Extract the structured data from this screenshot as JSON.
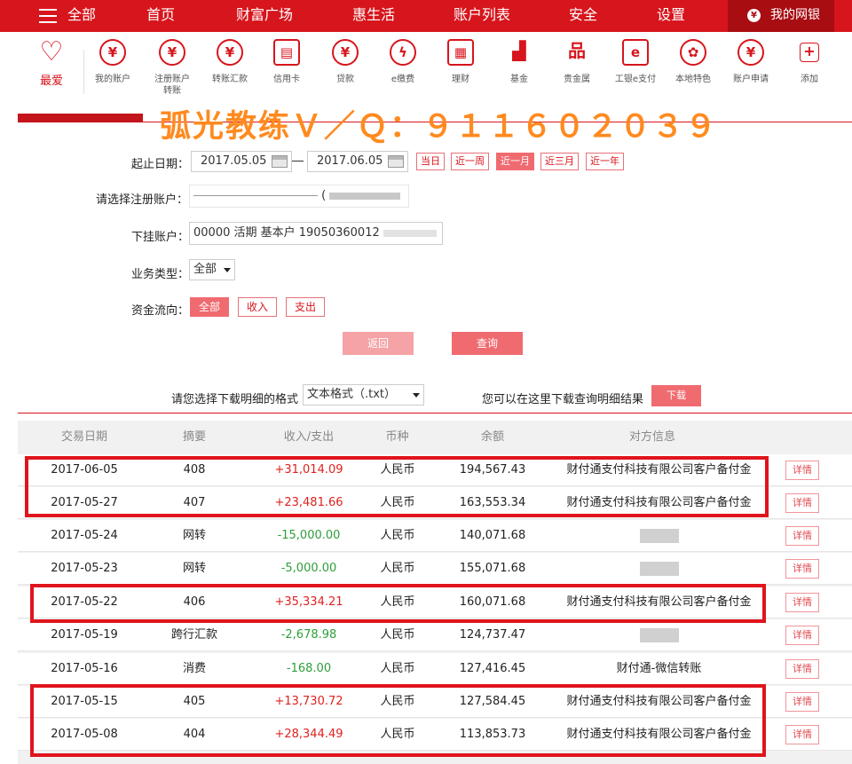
{
  "topbar": {
    "menu_label": "全部",
    "nav": [
      "首页",
      "财富广场",
      "惠生活",
      "账户列表",
      "安全",
      "设置"
    ],
    "mybank_label": "我的网银",
    "brand_color": "#d7151c"
  },
  "iconbar": {
    "favorite_label": "最爱",
    "items": [
      {
        "label": "我的账户",
        "icon": "yuan-coin-icon"
      },
      {
        "label": "注册账户转账",
        "icon": "yuan-transfer-icon"
      },
      {
        "label": "转账汇款",
        "icon": "yuan-remit-icon"
      },
      {
        "label": "信用卡",
        "icon": "credit-card-icon"
      },
      {
        "label": "贷款",
        "icon": "money-bag-icon"
      },
      {
        "label": "e缴费",
        "icon": "drop-icon"
      },
      {
        "label": "理财",
        "icon": "abacus-icon"
      },
      {
        "label": "基金",
        "icon": "chart-icon"
      },
      {
        "label": "贵金属",
        "icon": "gold-bars-icon"
      },
      {
        "label": "工银e支付",
        "icon": "epay-icon"
      },
      {
        "label": "本地特色",
        "icon": "film-reel-icon"
      },
      {
        "label": "账户申请",
        "icon": "yuan-apply-icon"
      },
      {
        "label": "添加",
        "icon": "add-icon"
      }
    ]
  },
  "watermark": "弧光教练Ｖ／Ｑ：９１１６０２０３９",
  "form": {
    "date_label": "起止日期：",
    "date_start": "2017.05.05",
    "date_end": "2017.06.05",
    "quick_ranges": [
      {
        "label": "当日",
        "active": false
      },
      {
        "label": "近一周",
        "active": false
      },
      {
        "label": "近一月",
        "active": true
      },
      {
        "label": "近三月",
        "active": false
      },
      {
        "label": "近一年",
        "active": false
      }
    ],
    "account_label": "请选择注册账户：",
    "account_paren": "(",
    "sub_account_label": "下挂账户：",
    "sub_account_value": "00000 活期 基本户 19050360012",
    "biz_type_label": "业务类型：",
    "biz_type_value": "全部",
    "flow_label": "资金流向：",
    "flow_options": [
      {
        "label": "全部",
        "active": true
      },
      {
        "label": "收入",
        "active": false
      },
      {
        "label": "支出",
        "active": false
      }
    ],
    "back_label": "返回",
    "query_label": "查询"
  },
  "download": {
    "format_prompt": "请您选择下载明细的格式",
    "format_value": "文本格式（.txt）",
    "hint": "您可以在这里下载查询明细结果",
    "button_label": "下载"
  },
  "table": {
    "headers": [
      "交易日期",
      "摘要",
      "收入/支出",
      "币种",
      "余额",
      "对方信息"
    ],
    "detail_label": "详情",
    "rows": [
      {
        "date": "2017-06-05",
        "summary": "408",
        "amount": "+31,014.09",
        "currency": "人民币",
        "balance": "194,567.43",
        "counterparty": "财付通支付科技有限公司客户备付金"
      },
      {
        "date": "2017-05-27",
        "summary": "407",
        "amount": "+23,481.66",
        "currency": "人民币",
        "balance": "163,553.34",
        "counterparty": "财付通支付科技有限公司客户备付金"
      },
      {
        "date": "2017-05-24",
        "summary": "网转",
        "amount": "-15,000.00",
        "currency": "人民币",
        "balance": "140,071.68",
        "counterparty": ""
      },
      {
        "date": "2017-05-23",
        "summary": "网转",
        "amount": "-5,000.00",
        "currency": "人民币",
        "balance": "155,071.68",
        "counterparty": ""
      },
      {
        "date": "2017-05-22",
        "summary": "406",
        "amount": "+35,334.21",
        "currency": "人民币",
        "balance": "160,071.68",
        "counterparty": "财付通支付科技有限公司客户备付金"
      },
      {
        "date": "2017-05-19",
        "summary": "跨行汇款",
        "amount": "-2,678.98",
        "currency": "人民币",
        "balance": "124,737.47",
        "counterparty": ""
      },
      {
        "date": "2017-05-16",
        "summary": "消费",
        "amount": "-168.00",
        "currency": "人民币",
        "balance": "127,416.45",
        "counterparty": "财付通-微信转账"
      },
      {
        "date": "2017-05-15",
        "summary": "405",
        "amount": "+13,730.72",
        "currency": "人民币",
        "balance": "127,584.45",
        "counterparty": "财付通支付科技有限公司客户备付金"
      },
      {
        "date": "2017-05-08",
        "summary": "404",
        "amount": "+28,344.49",
        "currency": "人民币",
        "balance": "113,853.73",
        "counterparty": "财付通支付科技有限公司客户备付金"
      }
    ]
  }
}
